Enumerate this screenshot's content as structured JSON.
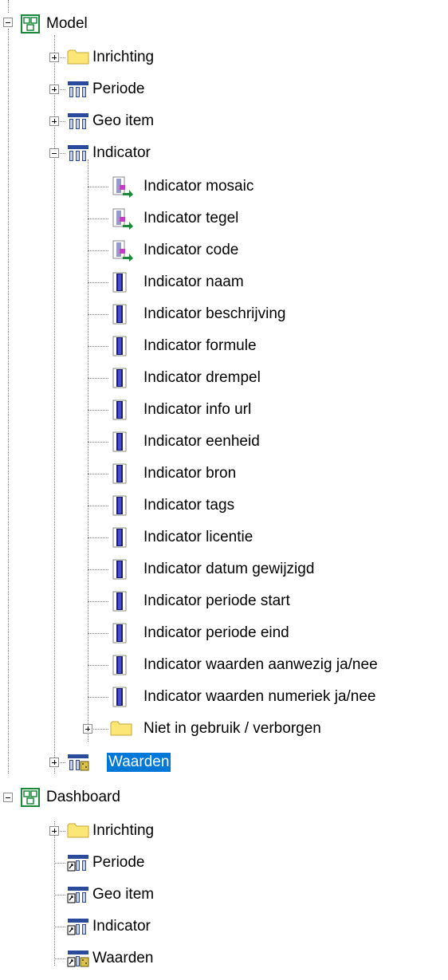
{
  "tree": {
    "model": {
      "label": "Model",
      "children": {
        "inrichting": "Inrichting",
        "periode": "Periode",
        "geo_item": "Geo item",
        "indicator": "Indicator",
        "indicator_children": [
          "Indicator mosaic",
          "Indicator tegel",
          "Indicator code",
          "Indicator naam",
          "Indicator beschrijving",
          "Indicator formule",
          "Indicator drempel",
          "Indicator info url",
          "Indicator eenheid",
          "Indicator bron",
          "Indicator tags",
          "Indicator licentie",
          "Indicator datum gewijzigd",
          "Indicator periode start",
          "Indicator periode eind",
          "Indicator waarden aanwezig ja/nee",
          "Indicator waarden numeriek ja/nee",
          "Niet in gebruik / verborgen"
        ],
        "waarden": "Waarden"
      }
    },
    "dashboard": {
      "label": "Dashboard",
      "children": [
        "Inrichting",
        "Periode",
        "Geo item",
        "Indicator",
        "Waarden"
      ]
    }
  },
  "selected": "Waarden",
  "icons": {
    "package": "package-icon",
    "folder": "folder-icon",
    "table": "table-icon",
    "table_link": "table-link-icon",
    "attribute": "attribute-icon",
    "attribute_ref": "attribute-reference-icon",
    "values": "values-table-icon"
  },
  "colors": {
    "selection": "#0078d7",
    "folder": "#fbe676",
    "table_header": "#2a4a9c",
    "package": "#1a8a3a"
  }
}
